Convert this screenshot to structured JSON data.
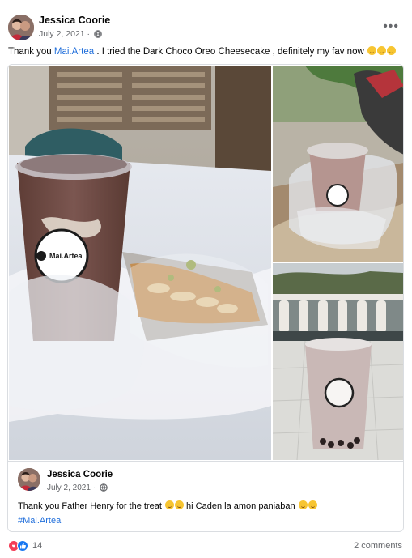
{
  "post": {
    "author": "Jessica Coorie",
    "date": "July 2, 2021",
    "dot": "·",
    "more_icon": "more-horizontal-icon",
    "caption_before": "Thank you ",
    "caption_mention": "Mai.Artea",
    "caption_after": " . I tried the Dark Choco Oreo Cheesecake , definitely my fav now "
  },
  "shared_post": {
    "author": "Jessica Coorie",
    "date": "July 2, 2021",
    "dot": "·",
    "text_1": "Thank you Father Henry for the treat ",
    "text_2": " hi Caden la amon paniaban ",
    "hashtag": "#Mai.Artea",
    "photos": [
      "cup-on-table-photo",
      "cup-in-bag-photo",
      "cup-on-railing-photo"
    ],
    "cup_logo_text": "Mai.Artea"
  },
  "footer": {
    "reaction_count": "14",
    "comments": "2 comments"
  },
  "colors": {
    "link": "#216fdb",
    "love": "#f33e58",
    "like": "#1877f2"
  }
}
